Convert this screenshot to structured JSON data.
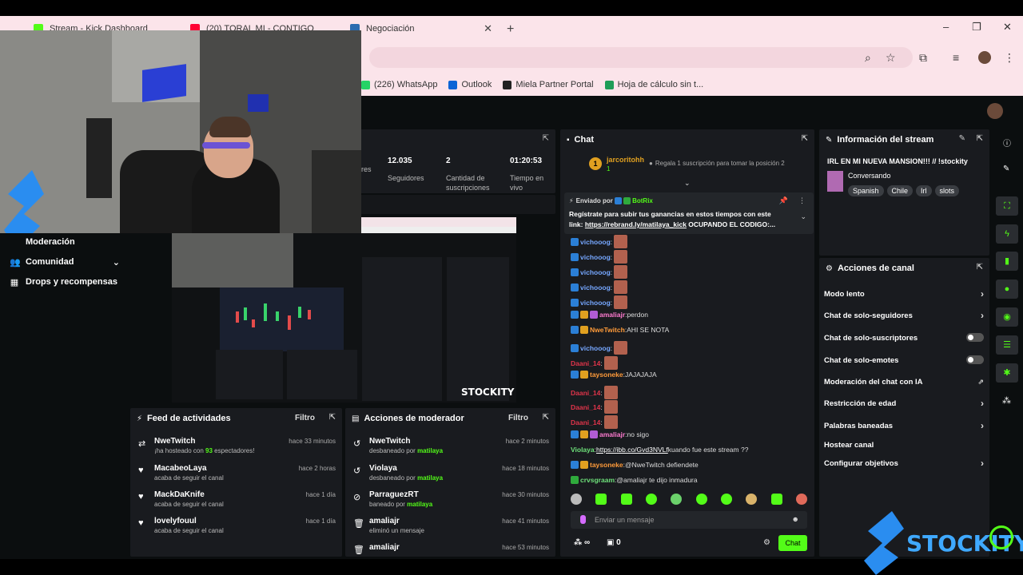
{
  "browser": {
    "tabs": [
      {
        "title": "Stream - Kick Dashboard",
        "favicon_color": "#53fc18"
      },
      {
        "title": "(20) TORAL MI - CONTIGO",
        "favicon_color": "#ff0033"
      },
      {
        "title": "Negociación",
        "favicon_color": "#2b6cb0"
      }
    ],
    "new_tab": "+",
    "window_controls": {
      "minimize": "–",
      "maximize": "❐",
      "close": "✕"
    },
    "bookmarks": [
      {
        "label": "(226) WhatsApp",
        "color": "#25d366"
      },
      {
        "label": "Outlook",
        "color": "#0a64d6"
      },
      {
        "label": "Miela Partner Portal",
        "color": "#222222"
      },
      {
        "label": "Hoja de cálculo sin t...",
        "color": "#1e9d57"
      }
    ]
  },
  "sidebar": {
    "items": [
      {
        "label": "Moderación",
        "icon": "shield-icon"
      },
      {
        "label": "Comunidad",
        "icon": "users-icon"
      },
      {
        "label": "Drops y recompensas",
        "icon": "gift-icon"
      }
    ]
  },
  "stats": [
    {
      "value": "",
      "label": "res"
    },
    {
      "value": "12.035",
      "label": "Seguidores"
    },
    {
      "value": "2",
      "label": "Cantidad de suscripciones"
    },
    {
      "value": "01:20:53",
      "label": "Tiempo en vivo"
    }
  ],
  "activity_feed": {
    "title": "Feed de actividades",
    "filter": "Filtro",
    "items": [
      {
        "name": "NweTwitch",
        "pre": "¡ha hosteado con ",
        "count": "93",
        "post": " espectadores!",
        "time": "hace 33 minutos",
        "icon": "host-icon"
      },
      {
        "name": "MacabeoLaya",
        "pre": "acaba de seguir el canal",
        "count": "",
        "post": "",
        "time": "hace 2 horas",
        "icon": "heart-icon"
      },
      {
        "name": "MackDaKnife",
        "pre": "acaba de seguir el canal",
        "count": "",
        "post": "",
        "time": "hace 1 día",
        "icon": "heart-icon"
      },
      {
        "name": "lovelyfouul",
        "pre": "acaba de seguir el canal",
        "count": "",
        "post": "",
        "time": "hace 1 día",
        "icon": "heart-icon"
      }
    ]
  },
  "mod_actions": {
    "title": "Acciones de moderador",
    "filter": "Filtro",
    "items": [
      {
        "name": "NweTwitch",
        "pre": "desbaneado por ",
        "by": "matilaya",
        "time": "hace 2 minutos",
        "icon": "undo-icon"
      },
      {
        "name": "Violaya",
        "pre": "desbaneado por ",
        "by": "matilaya",
        "time": "hace 18 minutos",
        "icon": "undo-icon"
      },
      {
        "name": "ParraguezRT",
        "pre": "baneado por ",
        "by": "matilaya",
        "time": "hace 30 minutos",
        "icon": "ban-icon"
      },
      {
        "name": "amaliajr",
        "pre": "eliminó un mensaje",
        "by": "",
        "time": "hace 41 minutos",
        "icon": "trash-icon"
      },
      {
        "name": "amaliajr",
        "pre": "",
        "by": "",
        "time": "hace 53 minutos",
        "icon": "trash-icon"
      }
    ]
  },
  "chat": {
    "title": "Chat",
    "top_gifter": {
      "name": "jarcoritohh",
      "rank": "1",
      "count": "1"
    },
    "gift_prompt": "Regala 1 suscripción para tomar la posición 2",
    "pinned": {
      "by_label": "Enviado por",
      "by": "BotRix",
      "text1": "Regístrate para subir tus ganancias en estos tiempos con este",
      "text2_pre": "link: ",
      "link": "https://rebrand.ly/matilaya_kick",
      "text2_post": " OCUPANDO EL CODIGO:..."
    },
    "messages": [
      {
        "user": "vichooog",
        "color": "blue",
        "text": "",
        "emote": true
      },
      {
        "user": "vichooog",
        "color": "blue",
        "text": "",
        "emote": true
      },
      {
        "user": "vichooog",
        "color": "blue",
        "text": "",
        "emote": true
      },
      {
        "user": "vichooog",
        "color": "blue",
        "text": "",
        "emote": true
      },
      {
        "user": "vichooog",
        "color": "blue",
        "text": "",
        "emote": true
      },
      {
        "user": "amaliajr",
        "color": "pink",
        "text": "perdon",
        "emote": false
      },
      {
        "user": "NweTwitch",
        "color": "orange",
        "text": "AHI SE NOTA",
        "emote": false
      },
      {
        "user": "vichooog",
        "color": "blue",
        "text": "",
        "emote": true
      },
      {
        "user": "Daani_14",
        "color": "red",
        "text": "",
        "emote": true
      },
      {
        "user": "taysoneke",
        "color": "orange",
        "text": "JAJAJAJA",
        "emote": false
      },
      {
        "user": "Daani_14",
        "color": "red",
        "text": "",
        "emote": true
      },
      {
        "user": "Daani_14",
        "color": "red",
        "text": "",
        "emote": true
      },
      {
        "user": "Daani_14",
        "color": "red",
        "text": "",
        "emote": true
      },
      {
        "user": "amaliajr",
        "color": "pink",
        "text": "no sigo",
        "emote": false
      },
      {
        "user": "Violaya",
        "color": "green",
        "text": " kuando fue este stream ??",
        "link": "https://ibb.co/Gvd3NVLf",
        "emote": false
      },
      {
        "user": "taysoneke",
        "color": "orange",
        "text": "@NweTwitch defiendete",
        "emote": false
      },
      {
        "user": "crvsgraam",
        "color": "green",
        "text": "@amaliajr te dijo inmadura",
        "emote": false
      }
    ],
    "input_placeholder": "Enviar un mensaje",
    "send_label": "Chat",
    "points": "∞",
    "gifts": "0"
  },
  "stream_info": {
    "title": "Información del stream",
    "stream_title": "IRL EN MI NUEVA MANSION!!! // !stockity",
    "category": "Conversando",
    "tags": [
      "Spanish",
      "Chile",
      "Irl",
      "slots"
    ]
  },
  "channel_actions": {
    "title": "Acciones de canal",
    "items": [
      {
        "label": "Modo lento",
        "kind": "chevron"
      },
      {
        "label": "Chat de solo-seguidores",
        "kind": "chevron"
      },
      {
        "label": "Chat de solo-suscriptores",
        "kind": "toggle"
      },
      {
        "label": "Chat de solo-emotes",
        "kind": "toggle"
      },
      {
        "label": "Moderación del chat con IA",
        "kind": "external"
      },
      {
        "label": "Restricción de edad",
        "kind": "chevron"
      },
      {
        "label": "Palabras baneadas",
        "kind": "chevron"
      },
      {
        "label": "Hostear canal",
        "kind": "none"
      },
      {
        "label": "Configurar objetivos",
        "kind": "chevron"
      }
    ]
  },
  "overlay": {
    "watermark": "STOCKITY"
  },
  "colors": {
    "kick_green": "#53fc18",
    "panel": "#191b1f",
    "bg": "#0b0e0f",
    "tab_bar": "#fbe4ea"
  }
}
